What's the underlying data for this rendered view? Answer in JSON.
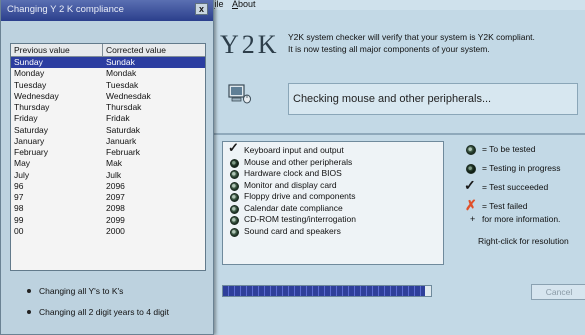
{
  "main_window": {
    "menu": [
      "File",
      "About"
    ],
    "logo_text": "Y2K",
    "intro_lines": [
      "Y2K system checker will verify that your system is Y2K compliant.",
      "It is now testing all major components of your system."
    ],
    "status_text": "Checking mouse and other peripherals...",
    "tests": [
      {
        "label": "Keyboard input and output",
        "state": "succeeded"
      },
      {
        "label": "Mouse and other peripherals",
        "state": "in-progress"
      },
      {
        "label": "Hardware clock and BIOS",
        "state": "to-be-tested"
      },
      {
        "label": "Monitor and display card",
        "state": "to-be-tested"
      },
      {
        "label": "Floppy drive and components",
        "state": "to-be-tested"
      },
      {
        "label": "Calendar date compliance",
        "state": "to-be-tested"
      },
      {
        "label": "CD-ROM testing/interrogation",
        "state": "to-be-tested"
      },
      {
        "label": "Sound card and speakers",
        "state": "to-be-tested"
      }
    ],
    "legend": {
      "to_be_tested": "= To be tested",
      "in_progress": "= Testing in progress",
      "succeeded": "= Test succeeded",
      "failed": "= Test failed",
      "more_info": "for more information."
    },
    "right_click_note": "Right-click for resolution",
    "progress": 0.97,
    "cancel_label": "Cancel"
  },
  "dialog": {
    "title": "Changing Y 2 K compliance",
    "close_label": "x",
    "columns": [
      "Previous value",
      "Corrected value"
    ],
    "rows": [
      [
        "Sunday",
        "Sundak"
      ],
      [
        "Monday",
        "Mondak"
      ],
      [
        "Tuesday",
        "Tuesdak"
      ],
      [
        "Wednesday",
        "Wednesdak"
      ],
      [
        "Thursday",
        "Thursdak"
      ],
      [
        "Friday",
        "Fridak"
      ],
      [
        "Saturday",
        "Saturdak"
      ],
      [
        "January",
        "Januark"
      ],
      [
        "February",
        "Februark"
      ],
      [
        "May",
        "Mak"
      ],
      [
        "July",
        "Julk"
      ],
      [
        "96",
        "2096"
      ],
      [
        "97",
        "2097"
      ],
      [
        "98",
        "2098"
      ],
      [
        "99",
        "2099"
      ],
      [
        "00",
        "2000"
      ]
    ],
    "selected_row": 0,
    "bullets": [
      "Changing all Y's to K's",
      "Changing all 2 digit years to 4 digit"
    ]
  },
  "colors": {
    "selection": "#2b3da0",
    "progress": "#2e3f9a",
    "failed_mark": "#e0502a",
    "titlebar": "#2b3f8c"
  },
  "icons": {
    "status": "mouse-computer-icon",
    "to_be_tested": "grey-dot-icon",
    "in_progress": "dark-dot-icon",
    "succeeded": "checkmark-icon",
    "failed": "red-x-icon"
  }
}
